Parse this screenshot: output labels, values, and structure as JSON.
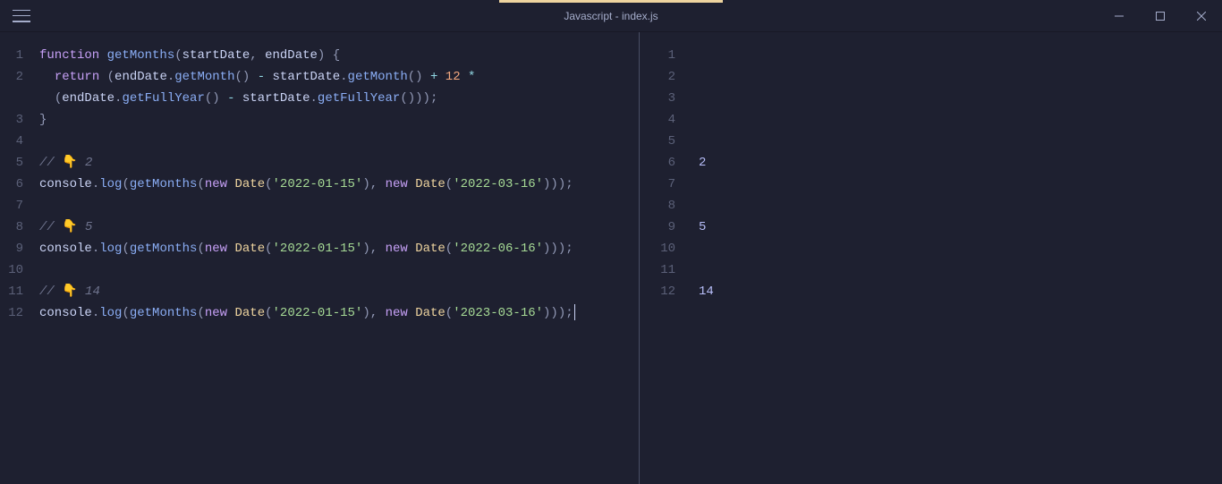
{
  "title": "Javascript - index.js",
  "left": {
    "gutter": [
      "1",
      "2",
      "",
      "3",
      "4",
      "5",
      "6",
      "7",
      "8",
      "9",
      "10",
      "11",
      "12"
    ],
    "lines": [
      {
        "t": "code",
        "tokens": [
          {
            "c": "kw",
            "v": "function"
          },
          {
            "c": "",
            "v": " "
          },
          {
            "c": "fn",
            "v": "getMonths"
          },
          {
            "c": "punct",
            "v": "("
          },
          {
            "c": "param",
            "v": "startDate"
          },
          {
            "c": "punct",
            "v": ", "
          },
          {
            "c": "param",
            "v": "endDate"
          },
          {
            "c": "punct",
            "v": ") {"
          }
        ]
      },
      {
        "t": "code",
        "tokens": [
          {
            "c": "",
            "v": "  "
          },
          {
            "c": "kw",
            "v": "return"
          },
          {
            "c": "",
            "v": " "
          },
          {
            "c": "punct",
            "v": "("
          },
          {
            "c": "obj",
            "v": "endDate"
          },
          {
            "c": "punct",
            "v": "."
          },
          {
            "c": "prop",
            "v": "getMonth"
          },
          {
            "c": "punct",
            "v": "() "
          },
          {
            "c": "op",
            "v": "-"
          },
          {
            "c": "",
            "v": " "
          },
          {
            "c": "obj",
            "v": "startDate"
          },
          {
            "c": "punct",
            "v": "."
          },
          {
            "c": "prop",
            "v": "getMonth"
          },
          {
            "c": "punct",
            "v": "() "
          },
          {
            "c": "op",
            "v": "+"
          },
          {
            "c": "",
            "v": " "
          },
          {
            "c": "num",
            "v": "12"
          },
          {
            "c": "",
            "v": " "
          },
          {
            "c": "op",
            "v": "*"
          }
        ]
      },
      {
        "t": "code",
        "tokens": [
          {
            "c": "",
            "v": "  "
          },
          {
            "c": "punct",
            "v": "("
          },
          {
            "c": "obj",
            "v": "endDate"
          },
          {
            "c": "punct",
            "v": "."
          },
          {
            "c": "prop",
            "v": "getFullYear"
          },
          {
            "c": "punct",
            "v": "() "
          },
          {
            "c": "op",
            "v": "-"
          },
          {
            "c": "",
            "v": " "
          },
          {
            "c": "obj",
            "v": "startDate"
          },
          {
            "c": "punct",
            "v": "."
          },
          {
            "c": "prop",
            "v": "getFullYear"
          },
          {
            "c": "punct",
            "v": "()));"
          }
        ]
      },
      {
        "t": "code",
        "tokens": [
          {
            "c": "punct",
            "v": "}"
          }
        ]
      },
      {
        "t": "code",
        "tokens": []
      },
      {
        "t": "code",
        "tokens": [
          {
            "c": "comment",
            "v": "// "
          },
          {
            "c": "emoji",
            "v": "👇"
          },
          {
            "c": "comment",
            "v": " 2"
          }
        ]
      },
      {
        "t": "code",
        "tokens": [
          {
            "c": "obj",
            "v": "console"
          },
          {
            "c": "punct",
            "v": "."
          },
          {
            "c": "prop",
            "v": "log"
          },
          {
            "c": "punct",
            "v": "("
          },
          {
            "c": "fn",
            "v": "getMonths"
          },
          {
            "c": "punct",
            "v": "("
          },
          {
            "c": "new-kw",
            "v": "new"
          },
          {
            "c": "",
            "v": " "
          },
          {
            "c": "class-nm",
            "v": "Date"
          },
          {
            "c": "punct",
            "v": "("
          },
          {
            "c": "str",
            "v": "'2022-01-15'"
          },
          {
            "c": "punct",
            "v": "), "
          },
          {
            "c": "new-kw",
            "v": "new"
          },
          {
            "c": "",
            "v": " "
          },
          {
            "c": "class-nm",
            "v": "Date"
          },
          {
            "c": "punct",
            "v": "("
          },
          {
            "c": "str",
            "v": "'2022-03-16'"
          },
          {
            "c": "punct",
            "v": ")));"
          }
        ]
      },
      {
        "t": "code",
        "tokens": []
      },
      {
        "t": "code",
        "tokens": [
          {
            "c": "comment",
            "v": "// "
          },
          {
            "c": "emoji",
            "v": "👇"
          },
          {
            "c": "comment",
            "v": " 5"
          }
        ]
      },
      {
        "t": "code",
        "tokens": [
          {
            "c": "obj",
            "v": "console"
          },
          {
            "c": "punct",
            "v": "."
          },
          {
            "c": "prop",
            "v": "log"
          },
          {
            "c": "punct",
            "v": "("
          },
          {
            "c": "fn",
            "v": "getMonths"
          },
          {
            "c": "punct",
            "v": "("
          },
          {
            "c": "new-kw",
            "v": "new"
          },
          {
            "c": "",
            "v": " "
          },
          {
            "c": "class-nm",
            "v": "Date"
          },
          {
            "c": "punct",
            "v": "("
          },
          {
            "c": "str",
            "v": "'2022-01-15'"
          },
          {
            "c": "punct",
            "v": "), "
          },
          {
            "c": "new-kw",
            "v": "new"
          },
          {
            "c": "",
            "v": " "
          },
          {
            "c": "class-nm",
            "v": "Date"
          },
          {
            "c": "punct",
            "v": "("
          },
          {
            "c": "str",
            "v": "'2022-06-16'"
          },
          {
            "c": "punct",
            "v": ")));"
          }
        ]
      },
      {
        "t": "code",
        "tokens": []
      },
      {
        "t": "code",
        "tokens": [
          {
            "c": "comment",
            "v": "// "
          },
          {
            "c": "emoji",
            "v": "👇"
          },
          {
            "c": "comment",
            "v": " 14"
          }
        ]
      },
      {
        "t": "code",
        "tokens": [
          {
            "c": "obj",
            "v": "console"
          },
          {
            "c": "punct",
            "v": "."
          },
          {
            "c": "prop",
            "v": "log"
          },
          {
            "c": "punct",
            "v": "("
          },
          {
            "c": "fn",
            "v": "getMonths"
          },
          {
            "c": "punct",
            "v": "("
          },
          {
            "c": "new-kw",
            "v": "new"
          },
          {
            "c": "",
            "v": " "
          },
          {
            "c": "class-nm",
            "v": "Date"
          },
          {
            "c": "punct",
            "v": "("
          },
          {
            "c": "str",
            "v": "'2022-01-15'"
          },
          {
            "c": "punct",
            "v": "), "
          },
          {
            "c": "new-kw",
            "v": "new"
          },
          {
            "c": "",
            "v": " "
          },
          {
            "c": "class-nm",
            "v": "Date"
          },
          {
            "c": "punct",
            "v": "("
          },
          {
            "c": "str",
            "v": "'2023-03-16'"
          },
          {
            "c": "punct",
            "v": ")));"
          }
        ],
        "cursor": true
      }
    ]
  },
  "right": {
    "gutter": [
      "1",
      "2",
      "3",
      "4",
      "5",
      "6",
      "7",
      "8",
      "9",
      "10",
      "11",
      "12"
    ],
    "output": [
      "",
      "",
      "",
      "",
      "",
      "2",
      "",
      "",
      "5",
      "",
      "",
      "14"
    ]
  }
}
